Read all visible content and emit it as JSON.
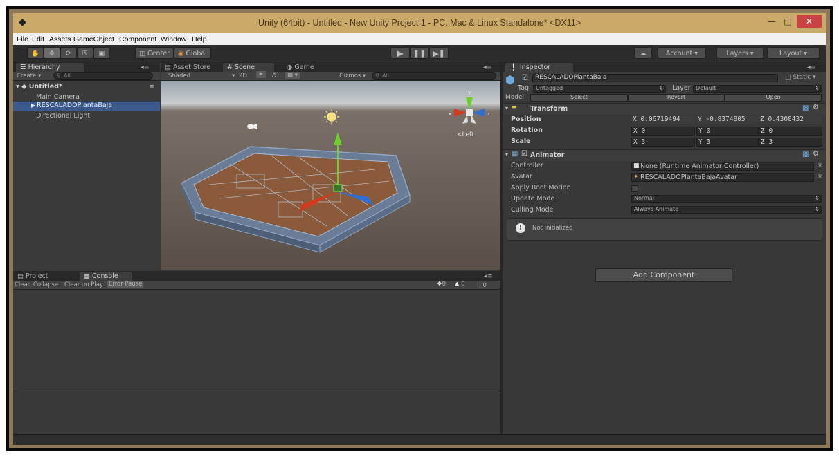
{
  "title": "Unity (64bit) - Untitled - New Unity Project 1 - PC, Mac & Linux Standalone* <DX11>",
  "menu": [
    "File",
    "Edit",
    "Assets",
    "GameObject",
    "Component",
    "Window",
    "Help"
  ],
  "toolbar": {
    "center_label": "Center",
    "global_label": "Global",
    "account_label": "Account",
    "layers_label": "Layers",
    "layout_label": "Layout"
  },
  "hierarchy": {
    "tab": "Hierarchy",
    "create_label": "Create",
    "search_placeholder": "All",
    "scene_name": "Untitled*",
    "items": [
      "Main Camera",
      "RESCALADOPlantaBaja",
      "Directional Light"
    ],
    "selected_index": 1
  },
  "scene": {
    "tabs": [
      "Asset Store",
      "Scene",
      "Game"
    ],
    "active_tab": "Scene",
    "shading_mode": "Shaded",
    "mode_2d": "2D",
    "gizmos_label": "Gizmos",
    "search_placeholder": "All",
    "gizmo_x": "x",
    "gizmo_y": "y",
    "gizmo_z": "z",
    "view_label": "<Left"
  },
  "console": {
    "tabs": [
      "Project",
      "Console"
    ],
    "active_tab": "Console",
    "buttons": [
      "Clear",
      "Collapse",
      "Clear on Play",
      "Error Pause"
    ],
    "active_button": "Error Pause",
    "counts": {
      "errors": "0",
      "warnings": "0",
      "messages": "0"
    }
  },
  "inspector": {
    "tab": "Inspector",
    "object_name": "RESCALADOPlantaBaja",
    "static_label": "Static",
    "tag_label": "Tag",
    "tag_value": "Untagged",
    "layer_label": "Layer",
    "layer_value": "Default",
    "model_label": "Model",
    "model_buttons": [
      "Select",
      "Revert",
      "Open"
    ],
    "transform": {
      "title": "Transform",
      "position_label": "Position",
      "rotation_label": "Rotation",
      "scale_label": "Scale",
      "position": [
        "X 0.06719494",
        "Y -0.8374805",
        "Z 0.4300432"
      ],
      "rotation": [
        "X 0",
        "Y 0",
        "Z 0"
      ],
      "scale": [
        "X 3",
        "Y 3",
        "Z 3"
      ]
    },
    "animator": {
      "title": "Animator",
      "controller_label": "Controller",
      "controller_value": "None (Runtime Animator Controller)",
      "avatar_label": "Avatar",
      "avatar_value": "RESCALADOPlantaBajaAvatar",
      "root_motion_label": "Apply Root Motion",
      "update_mode_label": "Update Mode",
      "update_mode_value": "Normal",
      "culling_mode_label": "Culling Mode",
      "culling_mode_value": "Always Animate",
      "status": "Not initialized"
    },
    "add_component": "Add Component"
  },
  "colors": {
    "titlebar": "#cba968",
    "selection": "#3d5a8c",
    "panel": "#383838",
    "close_button": "#c94343"
  }
}
